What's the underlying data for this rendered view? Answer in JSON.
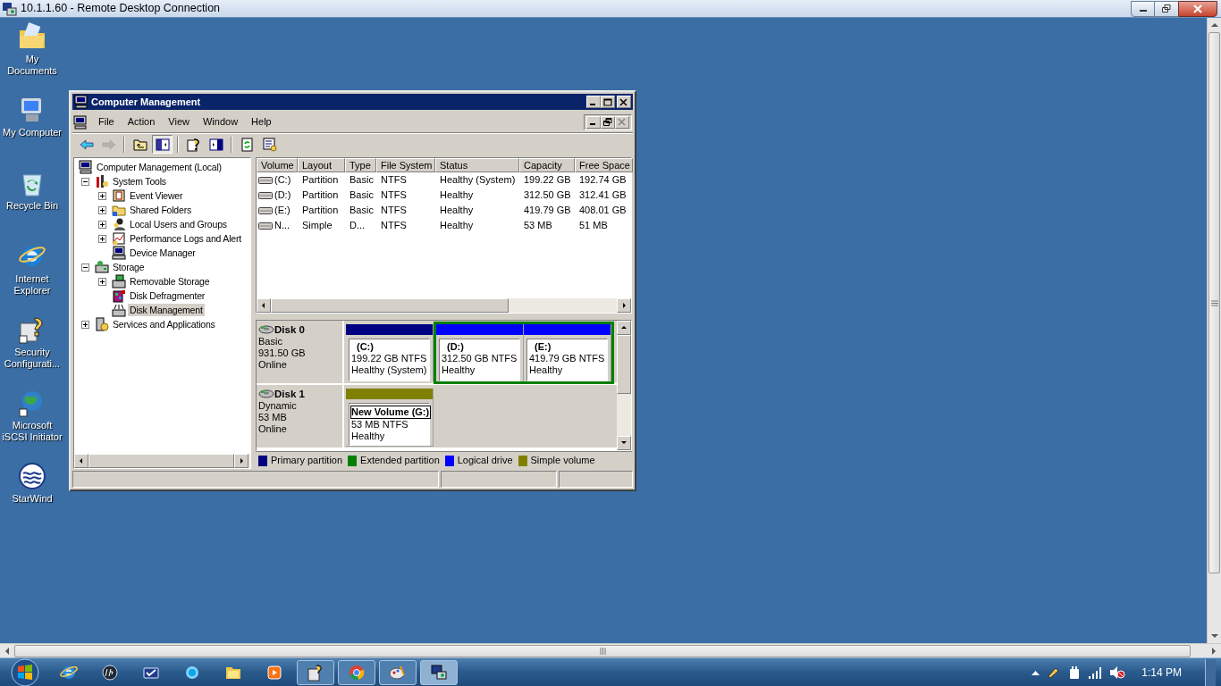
{
  "rdp": {
    "title": "10.1.1.60 - Remote Desktop Connection"
  },
  "desktop_icons": [
    {
      "kind": "documents",
      "label": "My Documents"
    },
    {
      "kind": "computer",
      "label": "My Computer"
    },
    {
      "kind": "recycle",
      "label": "Recycle Bin"
    },
    {
      "kind": "ie",
      "label": "Internet Explorer"
    },
    {
      "kind": "security",
      "label": "Security Configurati..."
    },
    {
      "kind": "iscsi",
      "label": "Microsoft iSCSI Initiator"
    },
    {
      "kind": "starwind",
      "label": "StarWind"
    }
  ],
  "window": {
    "title": "Computer Management",
    "menu": [
      "File",
      "Action",
      "View",
      "Window",
      "Help"
    ],
    "toolbar": [
      {
        "kind": "back",
        "pressed": false,
        "disabled": false
      },
      {
        "kind": "forward",
        "pressed": false,
        "disabled": true
      },
      {
        "kind": "up",
        "pressed": false,
        "disabled": false
      },
      {
        "kind": "tree",
        "pressed": true,
        "disabled": false
      },
      {
        "kind": "help",
        "pressed": false,
        "disabled": false
      },
      {
        "kind": "pane",
        "pressed": false,
        "disabled": false
      },
      {
        "kind": "refresh",
        "pressed": false,
        "disabled": false
      },
      {
        "kind": "properties",
        "pressed": false,
        "disabled": false
      }
    ],
    "tree": [
      {
        "kind": "computer",
        "label": "Computer Management (Local)",
        "selected": false,
        "children": [
          {
            "kind": "tools",
            "label": "System Tools",
            "expanded": true,
            "selected": false,
            "children": [
              {
                "kind": "log",
                "label": "Event Viewer",
                "expanded": false,
                "selected": false
              },
              {
                "kind": "folder",
                "label": "Shared Folders",
                "expanded": false,
                "selected": false
              },
              {
                "kind": "users",
                "label": "Local Users and Groups",
                "expanded": false,
                "selected": false
              },
              {
                "kind": "perf",
                "label": "Performance Logs and Alert",
                "expanded": false,
                "selected": false
              },
              {
                "kind": "device",
                "label": "Device Manager",
                "selected": false
              }
            ]
          },
          {
            "kind": "storage",
            "label": "Storage",
            "expanded": true,
            "selected": false,
            "children": [
              {
                "kind": "removable",
                "label": "Removable Storage",
                "expanded": false,
                "selected": false
              },
              {
                "kind": "defrag",
                "label": "Disk Defragmenter",
                "selected": false
              },
              {
                "kind": "diskmgmt",
                "label": "Disk Management",
                "selected": true
              }
            ]
          },
          {
            "kind": "services",
            "label": "Services and Applications",
            "expanded": false,
            "selected": false
          }
        ]
      }
    ],
    "volumes": {
      "columns": [
        "Volume",
        "Layout",
        "Type",
        "File System",
        "Status",
        "Capacity",
        "Free Space"
      ],
      "rows": [
        [
          "(C:)",
          "Partition",
          "Basic",
          "NTFS",
          "Healthy (System)",
          "199.22 GB",
          "192.74 GB"
        ],
        [
          "(D:)",
          "Partition",
          "Basic",
          "NTFS",
          "Healthy",
          "312.50 GB",
          "312.41 GB"
        ],
        [
          "(E:)",
          "Partition",
          "Basic",
          "NTFS",
          "Healthy",
          "419.79 GB",
          "408.01 GB"
        ],
        [
          "N...",
          "Simple",
          "D...",
          "NTFS",
          "Healthy",
          "53 MB",
          "51 MB"
        ]
      ]
    },
    "disks": [
      {
        "name": "Disk 0",
        "type": "Basic",
        "size": "931.50 GB",
        "status": "Online",
        "partitions": [
          {
            "kind": "primary",
            "label": "(C:)",
            "size": "199.22 GB NTFS",
            "status": "Healthy (System)",
            "selected": false
          },
          {
            "kind": "extended",
            "children": [
              {
                "kind": "logical",
                "label": "(D:)",
                "size": "312.50 GB NTFS",
                "status": "Healthy",
                "selected": false
              },
              {
                "kind": "logical",
                "label": "(E:)",
                "size": "419.79 GB NTFS",
                "status": "Healthy",
                "selected": false
              }
            ]
          }
        ]
      },
      {
        "name": "Disk 1",
        "type": "Dynamic",
        "size": "53 MB",
        "status": "Online",
        "partitions": [
          {
            "kind": "simple",
            "label": "New Volume  (G:)",
            "size": "53 MB NTFS",
            "status": "Healthy",
            "selected": true
          }
        ]
      }
    ],
    "legend": [
      {
        "label": "Primary partition",
        "color": "#000080"
      },
      {
        "label": "Extended partition",
        "color": "#008000"
      },
      {
        "label": "Logical drive",
        "color": "#0000ff"
      },
      {
        "label": "Simple volume",
        "color": "#808000"
      }
    ]
  },
  "taskbar": {
    "items": [
      {
        "kind": "ie",
        "open": false,
        "selected": false
      },
      {
        "kind": "hp",
        "open": false,
        "selected": false
      },
      {
        "kind": "mail",
        "open": false,
        "selected": false
      },
      {
        "kind": "orb",
        "open": false,
        "selected": false
      },
      {
        "kind": "folder",
        "open": false,
        "selected": false
      },
      {
        "kind": "media",
        "open": false,
        "selected": false
      },
      {
        "kind": "security",
        "open": true,
        "selected": false
      },
      {
        "kind": "chrome",
        "open": true,
        "selected": false
      },
      {
        "kind": "paint",
        "open": true,
        "selected": false
      },
      {
        "kind": "rdp",
        "open": true,
        "selected": true
      }
    ],
    "clock": "1:14 PM"
  }
}
